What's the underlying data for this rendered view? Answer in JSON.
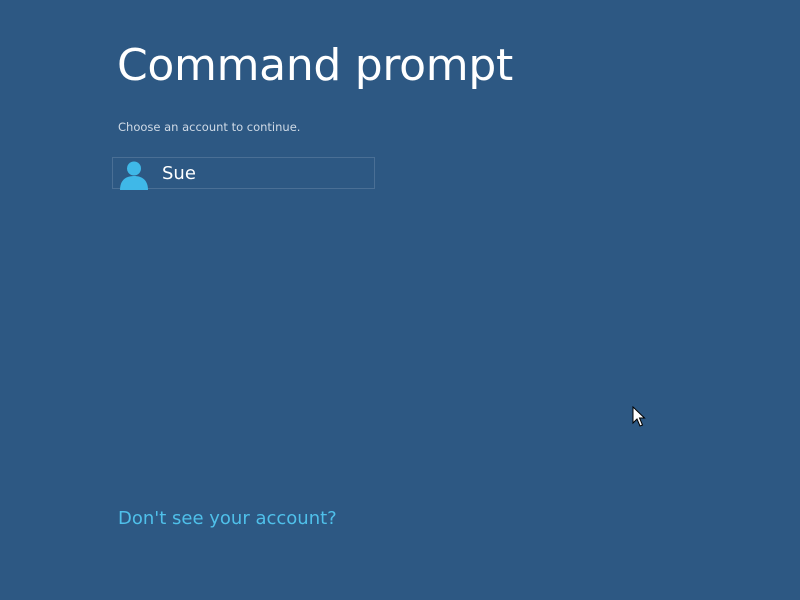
{
  "page": {
    "title": "Command prompt",
    "subtitle": "Choose an account to continue."
  },
  "accounts": [
    {
      "name": "Sue",
      "icon": "user-account-icon"
    }
  ],
  "links": {
    "missing_account": "Don't see your account?"
  },
  "colors": {
    "background": "#2d5883",
    "title_text": "#ffffff",
    "subtitle_text": "#cfdae6",
    "link": "#4fc0ea",
    "user_icon": "#3fb8e8",
    "tile_border": "#4a6f95"
  },
  "icons": {
    "pointer": "mouse-pointer-icon"
  }
}
